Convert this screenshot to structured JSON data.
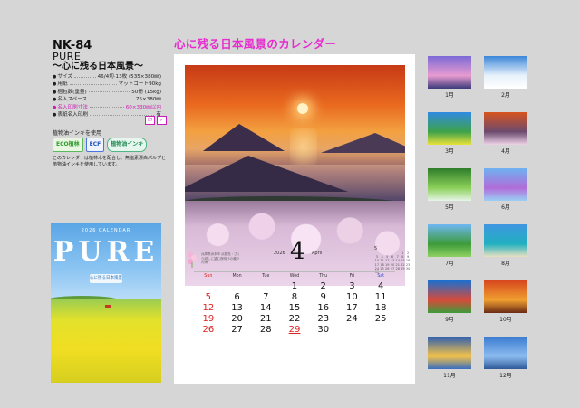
{
  "product": {
    "code": "NK-84",
    "series": "PURE",
    "subtitle": "～心に残る日本風景～"
  },
  "specs": [
    {
      "key": "サイズ",
      "value": "46/4切·13枚 (535×380㎜)",
      "highlight": false
    },
    {
      "key": "用紙",
      "value": "マットコート90kg",
      "highlight": false
    },
    {
      "key": "梱包数(重量)",
      "value": "50冊 (15kg)",
      "highlight": false
    },
    {
      "key": "名入スペース",
      "value": "75×380㎜",
      "highlight": false
    },
    {
      "key": "名入印刷寸法",
      "value": "60×330㎜以内",
      "highlight": true
    },
    {
      "key": "表紙名入印刷",
      "value": "有",
      "highlight": false
    }
  ],
  "print_icons": [
    "印",
    "✓"
  ],
  "ink_label": "植物油インキを使用",
  "eco_badges": [
    "ECO植林",
    "ECF",
    "植物油インキ"
  ],
  "note": "このカレンダーは植林木を配合し、無塩素漂白パルプと植物油インキを使用しています。",
  "cover": {
    "calendar_text": "2026 CALENDAR",
    "title": "PURE",
    "sub": "心に残る日本風景"
  },
  "headline": "心に残る日本風景のカレンダー",
  "calendar": {
    "blurb": "兵庫県洲本市 淡路島・さくら越しに望む夜明けの瀬戸内海",
    "year": "2026",
    "month_number": "4",
    "month_name": "April",
    "mini_month": "5",
    "mini_days": [
      "",
      "",
      "",
      "",
      "",
      "1",
      "2",
      "3",
      "4",
      "5",
      "6",
      "7",
      "8",
      "9",
      "10",
      "11",
      "12",
      "13",
      "14",
      "15",
      "16",
      "17",
      "18",
      "19",
      "20",
      "21",
      "22",
      "23",
      "24",
      "25",
      "26",
      "27",
      "28",
      "29",
      "30",
      "31"
    ],
    "weekdays": [
      "Sun",
      "Mon",
      "Tue",
      "Wed",
      "Thu",
      "Fri",
      "Sat"
    ],
    "weeks": [
      [
        "",
        "",
        "",
        "1",
        "2",
        "3",
        "4"
      ],
      [
        "5",
        "6",
        "7",
        "8",
        "9",
        "10",
        "11"
      ],
      [
        "12",
        "13",
        "14",
        "15",
        "16",
        "17",
        "18"
      ],
      [
        "19",
        "20",
        "21",
        "22",
        "23",
        "24",
        "25"
      ],
      [
        "26",
        "27",
        "28",
        "29",
        "30",
        "",
        ""
      ]
    ],
    "holidays": [
      "29"
    ]
  },
  "thumbnails": [
    {
      "label": "1月",
      "colors": [
        "#7c6ad6",
        "#e79bd0",
        "#3a3a7a"
      ]
    },
    {
      "label": "2月",
      "colors": [
        "#3c86d9",
        "#e8f2fb",
        "#ffffff"
      ]
    },
    {
      "label": "3月",
      "colors": [
        "#2f8ae0",
        "#3ea24a",
        "#e9e23a"
      ]
    },
    {
      "label": "4月",
      "colors": [
        "#d8541f",
        "#6c4a6e",
        "#eed3e8"
      ]
    },
    {
      "label": "5月",
      "colors": [
        "#2f7d2a",
        "#8bd05a",
        "#e7f5e7"
      ]
    },
    {
      "label": "6月",
      "colors": [
        "#6fb2f0",
        "#b06cd8",
        "#9ad0f4"
      ]
    },
    {
      "label": "7月",
      "colors": [
        "#6db7f2",
        "#3d9b3a",
        "#8fd163"
      ]
    },
    {
      "label": "8月",
      "colors": [
        "#3f96e0",
        "#21b0c0",
        "#e9e1c1"
      ]
    },
    {
      "label": "9月",
      "colors": [
        "#1b6fd0",
        "#d74a3a",
        "#3b9c3a"
      ]
    },
    {
      "label": "10月",
      "colors": [
        "#d7461e",
        "#f0a030",
        "#6a2a16"
      ]
    },
    {
      "label": "11月",
      "colors": [
        "#2e5fb0",
        "#f3c24a",
        "#3a6ec0"
      ]
    },
    {
      "label": "12月",
      "colors": [
        "#3a7ad0",
        "#8cbcef",
        "#2f5a9a"
      ]
    }
  ]
}
